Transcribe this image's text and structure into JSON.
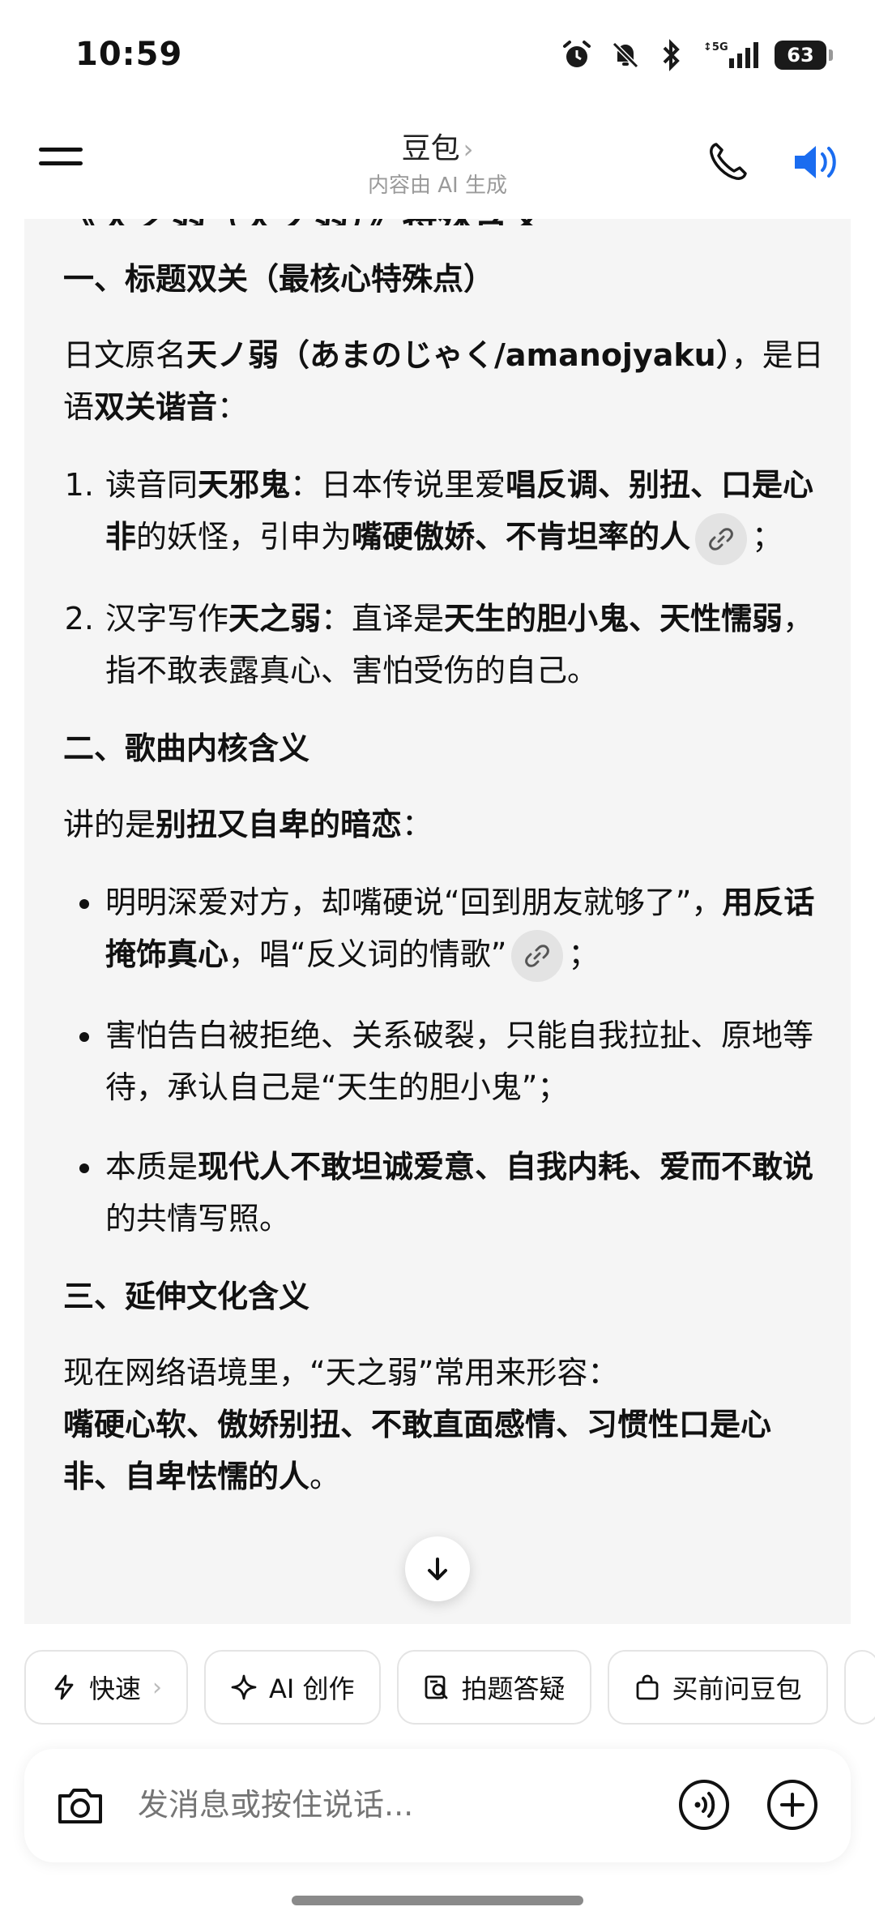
{
  "status": {
    "time": "10:59",
    "network": "5G",
    "battery": "63"
  },
  "header": {
    "title": "豆包",
    "subtitle": "内容由 AI 生成"
  },
  "content": {
    "cut_title": "《天之弱（天ノ弱）》特殊含义",
    "s1_heading": "一、标题双关（最核心特殊点）",
    "s1_p_a": "日文原名",
    "s1_p_b": "天ノ弱（あまのじゃく/amanojyaku）",
    "s1_p_c": "，是日语",
    "s1_p_d": "双关谐音",
    "s1_p_e": "：",
    "li1_a": "读音同",
    "li1_b": "天邪鬼",
    "li1_c": "：日本传说里爱",
    "li1_d": "唱反调、别扭、口是心非",
    "li1_e": "的妖怪，引申为",
    "li1_f": "嘴硬傲娇、不肯坦率的人",
    "li1_g": "；",
    "li2_a": "汉字写作",
    "li2_b": "天之弱",
    "li2_c": "：直译是",
    "li2_d": "天生的胆小鬼、天性懦弱",
    "li2_e": "，指不敢表露真心、害怕受伤的自己。",
    "s2_heading": "二、歌曲内核含义",
    "s2_p_a": "讲的是",
    "s2_p_b": "别扭又自卑的暗恋",
    "s2_p_c": "：",
    "b1_a": "明明深爱对方，却嘴硬说“回到朋友就够了”，",
    "b1_b": "用反话掩饰真心",
    "b1_c": "，唱“反义词的情歌”",
    "b1_d": "；",
    "b2": "害怕告白被拒绝、关系破裂，只能自我拉扯、原地等待，承认自己是“天生的胆小鬼”；",
    "b3_a": "本质是",
    "b3_b": "现代人不敢坦诚爱意、自我内耗、爱而不敢说",
    "b3_c": "的共情写照。",
    "s3_heading": "三、延伸文化含义",
    "s3_p_a": "现在网络语境里，“天之弱”常用来形容：",
    "s3_p_b": "嘴硬心软、傲娇别扭、不敢直面感情、习惯性口是心非、自卑怯懦的人",
    "s3_p_c": "。"
  },
  "chips": [
    {
      "label": "快速",
      "icon": "lightning-icon"
    },
    {
      "label": "AI 创作",
      "icon": "sparkle-icon"
    },
    {
      "label": "拍题答疑",
      "icon": "photo-search-icon"
    },
    {
      "label": "买前问豆包",
      "icon": "shopping-bag-icon"
    }
  ],
  "input": {
    "placeholder": "发消息或按住说话..."
  },
  "colors": {
    "accent": "#1a6cf0",
    "card_bg": "#f5f5f5"
  }
}
